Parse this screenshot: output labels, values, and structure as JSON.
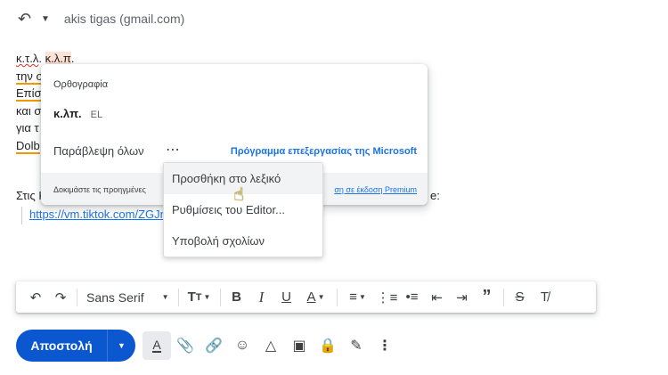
{
  "header": {
    "recipient": "akis tigas (gmail.com)"
  },
  "body": {
    "line1_a": "κ.τ.λ",
    "line1_sep": ".",
    "line1_b": "κ.λ.π",
    "line1_end": ".",
    "line2": "την σ",
    "line3": "Επίσ",
    "line4": "και σ",
    "line5": "για τ",
    "line6": "Dolb",
    "share_line": "Στις Κ",
    "share_line_end": "e:",
    "link": "https://vm.tiktok.com/ZGJn"
  },
  "spell_popup": {
    "title": "Ορθογραφία",
    "suggestion": "κ.λπ.",
    "language": "EL",
    "ignore_all": "Παράβλεψη όλων",
    "more": "⋯",
    "microsoft_editor": "Πρόγραμμα επεξεργασίας της Microsoft",
    "try_premium": "Δοκιμάστε τις προηγμένες",
    "premium_link": "ση σε έκδοση Premium"
  },
  "context_menu": {
    "items": [
      {
        "label": "Προσθήκη στο λεξικό"
      },
      {
        "label": "Ρυθμίσεις του Editor..."
      },
      {
        "label": "Υποβολή σχολίων"
      }
    ]
  },
  "formatting_bar": {
    "font": "Sans Serif"
  },
  "compose": {
    "send_label": "Αποστολή"
  },
  "colors": {
    "send": "#0b57d0",
    "link": "#1a73e8",
    "spell_error": "#d93025"
  }
}
